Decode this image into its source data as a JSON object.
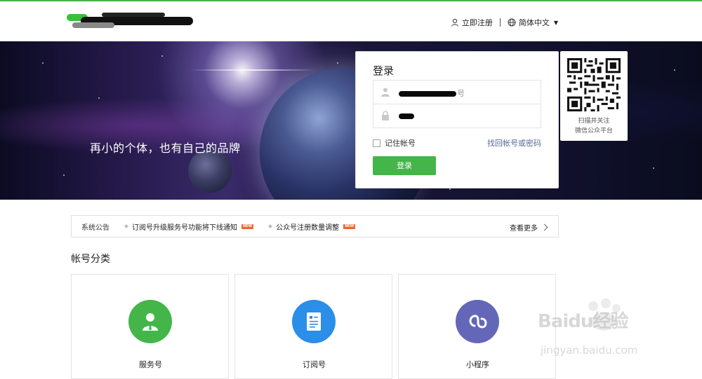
{
  "header": {
    "register_label": "立即注册",
    "language_label": "简体中文"
  },
  "banner": {
    "slogan": "再小的个体，也有自己的品牌"
  },
  "login": {
    "title": "登录",
    "username_suffix": "号",
    "remember_label": "记住帐号",
    "forgot_label": "找回帐号或密码",
    "submit_label": "登录"
  },
  "qr": {
    "caption_line1": "扫描并关注",
    "caption_line2": "微信公众平台"
  },
  "notice": {
    "label": "系统公告",
    "items": [
      {
        "text": "订阅号升级服务号功能将下线通知",
        "badge": "NEW"
      },
      {
        "text": "公众号注册数量调整",
        "badge": "NEW"
      }
    ],
    "more_label": "查看更多"
  },
  "account_types": {
    "title": "帐号分类",
    "cards": [
      {
        "label": "服务号",
        "icon": "person-icon",
        "color": "#44b549"
      },
      {
        "label": "订阅号",
        "icon": "document-icon",
        "color": "#2b8ee8"
      },
      {
        "label": "小程序",
        "icon": "link-icon",
        "color": "#6467b8"
      }
    ]
  },
  "watermark": {
    "text": "Baidu经验",
    "subtext": "jingyan.baidu.com"
  },
  "colors": {
    "brand_green": "#44b549",
    "link_blue": "#576b95"
  }
}
